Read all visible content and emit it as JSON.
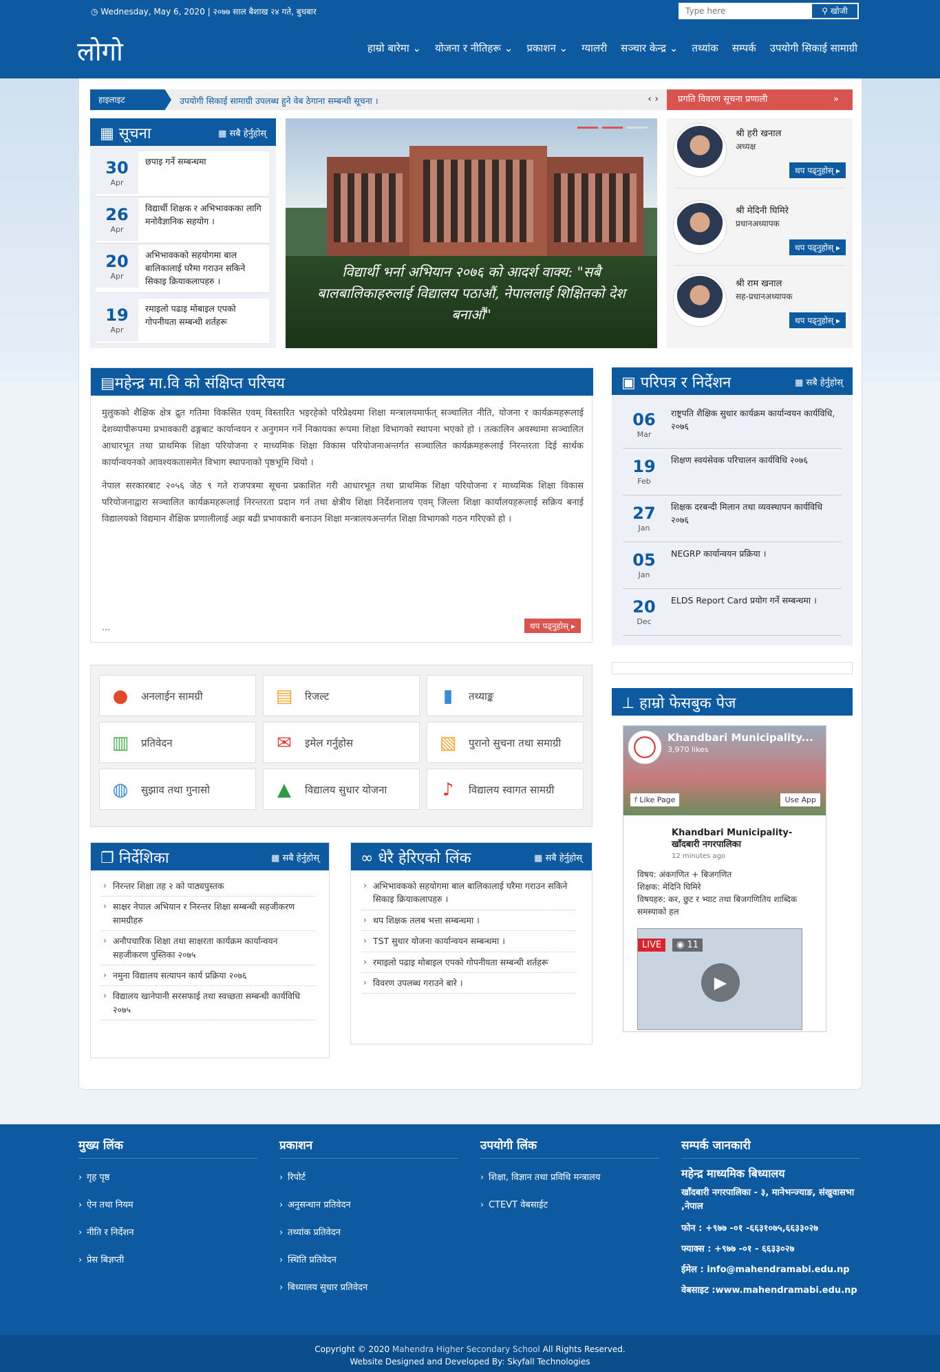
{
  "topbar": {
    "date": "Wednesday, May 6, 2020 | २०७७ साल बैशाख २४ गते, बुधबार",
    "search_placeholder": "Type here",
    "search_label": "खोजी"
  },
  "nav": {
    "logo": "लोगो",
    "items": [
      "हाम्रो बारेमा ⌄",
      "योजना र नीतिहरू ⌄",
      "प्रकाशन ⌄",
      "ग्यालरी",
      "सञ्चार केन्द्र ⌄",
      "तथ्यांक",
      "सम्पर्क",
      "उपयोगी सिकाई सामाग्री"
    ]
  },
  "highlight": {
    "tag": "हाइलाइट",
    "text": "उपयोगी सिकाई सामाग्री उपलब्ध हुने वेब ठेगाना सम्बन्धी सूचना ।",
    "arrows": "‹ ›"
  },
  "system_button": {
    "label": "प्रगति विवरण सूचना प्रणाली",
    "chevron": "»"
  },
  "notice": {
    "title": "सूचना",
    "view_all": "सबै हेर्नुहोस्",
    "items": [
      {
        "day": "30",
        "month": "Apr",
        "text": "छपाइ गर्ने सम्बन्धमा"
      },
      {
        "day": "26",
        "month": "Apr",
        "text": "विद्यार्थी शिक्षक र अभिभावकका लागि मनोवैज्ञानिक सहयोग ।"
      },
      {
        "day": "20",
        "month": "Apr",
        "text": "अभिभावकको सहयोगमा बाल बालिकालाई घरैमा गराउन सकिने सिकाइ क्रियाकलापहरु ।"
      },
      {
        "day": "19",
        "month": "Apr",
        "text": "रमाइलो पढाइ मोबाइल एपको गोपनीयता सम्बन्धी शर्तहरू"
      }
    ]
  },
  "slider": {
    "caption": "विद्यार्थी भर्ना अभियान २०७६ को आदर्श वाक्य: \"सबै बालबालिकाहरुलाई विद्यालय पठाऔं, नेपाललाई शिक्षितको देश बनाऔं\""
  },
  "staff": [
    {
      "name": "श्री हरी खनाल",
      "role": "अध्यक्ष",
      "more": "थप पढ्नुहोस्"
    },
    {
      "name": "श्री मेदिनी घिमिरे",
      "role": "प्रधानअध्यापक",
      "more": "थप पढ्नुहोस्"
    },
    {
      "name": "श्री राम खनाल",
      "role": "सह-प्रधानअध्यापक",
      "more": "थप पढ्नुहोस्"
    }
  ],
  "intro": {
    "title": "महेन्द्र मा.वि को संक्षिप्त परिचय",
    "p1": "मुलुकको शैक्षिक क्षेत्र द्रुत गतिमा विकसित एवम् विस्तारित भइरहेको परिप्रेक्ष्यमा शिक्षा मन्त्रालयमार्फत् सञ्चालित नीति, योजना र कार्यक्रमहरूलाई देशव्यापीरूपमा प्रभावकारी ढङ्गबाट कार्यान्वयन र अनुगमन गर्ने निकायका रूपमा शिक्षा विभागको स्थापना भएको हो । तत्कालिन अवस्थामा सञ्चालित आधारभूत तथा प्राथमिक शिक्षा परियोजना र माध्यमिक शिक्षा विकास परियोजनाअन्तर्गत सञ्चालित कार्यक्रमहरूलाई निरन्तरता दिई सार्थक कार्यान्वयनको आवश्यकतासमेत विभाग स्थापनाको पृष्ठभूमि थियो ।",
    "p2": "नेपाल सरकारबाट २०५६ जेठ ९ गते राजपत्रमा सूचना प्रकाशित गरी आधारभूत तथा प्राथमिक शिक्षा परियोजना र माध्यमिक शिक्षा विकास परियोजनाद्वारा सञ्चालित कार्यक्रमहरूलाई निरन्तरता प्रदान गर्न तथा क्षेत्रीय शिक्षा निर्देशनालय एवम् जिल्ला शिक्षा कार्यालयहरूलाई सक्रिय बनाई विद्यालयको विद्यमान शैक्षिक प्रणालीलाई अझ बढी प्रभावकारी बनाउन शिक्षा मन्त्रालयअन्तर्गत शिक्षा विभागको गठन गरिएको हो ।",
    "ellipsis": "...",
    "more": "थप पढ्नुहोस्"
  },
  "circulars": {
    "title": "परिपत्र र निर्देशन",
    "view_all": "सबै हेर्नुहोस्",
    "items": [
      {
        "day": "06",
        "month": "Mar",
        "text": "राष्ट्रपति शैक्षिक सुधार कार्यक्रम कार्यान्वयन कार्यविधि, २०७६"
      },
      {
        "day": "19",
        "month": "Feb",
        "text": "शिक्षण स्वयंसेवक परिचालन कार्यविधि २०७६"
      },
      {
        "day": "27",
        "month": "Jan",
        "text": "शिक्षक दरबन्दी मिलान तथा व्यवस्थापन कार्यविधि २०७६"
      },
      {
        "day": "05",
        "month": "Jan",
        "text": "NEGRP कार्यान्वयन प्रक्रिया ।"
      },
      {
        "day": "20",
        "month": "Dec",
        "text": "ELDS Report Card प्रयोग गर्ने सम्बन्धमा ।"
      }
    ]
  },
  "quick": [
    {
      "label": "अनलाईन सामग्री",
      "icon": "globe-icon",
      "glyph": "●",
      "color": "#e04a2a"
    },
    {
      "label": "रिजल्ट",
      "icon": "document-icon",
      "glyph": "▤",
      "color": "#f0a830"
    },
    {
      "label": "तथ्याङ्क",
      "icon": "file-icon",
      "glyph": "▮",
      "color": "#3a8ad6"
    },
    {
      "label": "प्रतिवेदन",
      "icon": "bar-chart-icon",
      "glyph": "▥",
      "color": "#4caf50"
    },
    {
      "label": "इमेल गर्नुहोस",
      "icon": "mail-icon",
      "glyph": "✉",
      "color": "#e53935"
    },
    {
      "label": "पुरानो सुचना तथा समाग्री",
      "icon": "archive-file-icon",
      "glyph": "▧",
      "color": "#f0a830"
    },
    {
      "label": "सुझाव तथा गुनासो",
      "icon": "chat-icon",
      "glyph": "◍",
      "color": "#3a8ad6"
    },
    {
      "label": "विद्यालय सुधार योजना",
      "icon": "graduation-cap-icon",
      "glyph": "▲",
      "color": "#2e9a4a"
    },
    {
      "label": "विद्यालय स्वागत सामग्री",
      "icon": "bell-icon",
      "glyph": "♪",
      "color": "#e53935"
    }
  ],
  "facebook": {
    "title": "हाम्रो फेसबुक पेज",
    "page_name": "Khandbari Municipality...",
    "likes": "3,970 likes",
    "like_page": "Like Page",
    "use_app": "Use App",
    "post_name": "Khandbari Municipality- खाँदबारी नगरपालिका",
    "post_time": "12 minutes ago",
    "post_text": "विषय: अंकगणित + बिजगणित\nशिक्षक: मेदिनि घिमिरे\nविषयहरु: कर, छुट र भ्याट तथा बिजगणितिय शाब्दिक समस्याको हल",
    "live": "LIVE",
    "viewers": "11"
  },
  "directives": {
    "title": "निर्देशिका",
    "view_all": "सबै हेर्नुहोस्",
    "items": [
      "निरन्तर शिक्षा तह २ को पाठ्यपुस्तक",
      "साक्षर नेपाल अभियान र निरन्तर शिक्षा सम्बन्धी सहजीकरण सामग्रीहरु",
      "अनौपचारिक शिक्षा तथा साक्षरता कार्यक्रम कार्यान्वयन सहजीकरण पुस्तिका २०७५",
      "नमुना विद्यालय सत्यापन कार्य प्रक्रिया २०७६",
      "विद्यालय खानेपानी सरसफाई तथा स्वच्छता सम्बन्धी कार्यविधि २०७५"
    ]
  },
  "popular": {
    "title": "धेरै हेरिएको लिंक",
    "view_all": "सबै हेर्नुहोस्",
    "items": [
      "अभिभावकको सहयोगमा बाल बालिकालाई घरैमा गराउन सकिने सिकाइ क्रियाकलापहरु ।",
      "थप शिक्षक तलब भत्ता सम्बन्धमा ।",
      "TST सुधार योजना कार्यान्वयन सम्बन्धमा ।",
      "रमाइलो पढाइ मोबाइल एपको गोपनीयता सम्बन्धी शर्तहरू",
      "विवरण उपलब्ध गराउने बारे ।"
    ]
  },
  "footer": {
    "main_links": {
      "title": "मुख्य लिंक",
      "items": [
        "गृह पृष्ठ",
        "ऐन तथा नियम",
        "नीति र निर्देशन",
        "प्रेस बिज्ञप्ती"
      ]
    },
    "publications": {
      "title": "प्रकाशन",
      "items": [
        "रिपोर्ट",
        "अनुसन्धान प्रतिवेदन",
        "तथ्यांक प्रतिवेदन",
        "स्थिति प्रतिवेदन",
        "बिध्यालय सुधार प्रतिवेदन"
      ]
    },
    "useful": {
      "title": "उपयोगी लिंक",
      "items": [
        "शिक्षा, विज्ञान तथा प्रविधि मन्त्रालय",
        "CTEVT वेबसाईट"
      ]
    },
    "contact": {
      "title": "सम्पर्क जानकारी",
      "org": "महेन्द्र माध्यमिक बिध्यालय",
      "address": "खाँदबारी नगरपालिका - ३, मानेभन्ज्याङ, संखुवासभा ,नेपाल",
      "phone": "फोन : +९७७ -०१ -६६३१०७५,६६३३०२७",
      "fax": "फ्याक्स : +९७७ -०१ - ६६३३०२७",
      "email": "ईमेल : info@mahendramabi.edu.np",
      "web": "वेबसाइट :www.mahendramabi.edu.np"
    }
  },
  "copyright": {
    "prefix": "Copyright © 2020",
    "school": "Mahendra Higher Secondary School",
    "suffix": "All Rights Reserved.",
    "credit": "Website Designed and Developed By: Skyfall Technologies"
  }
}
